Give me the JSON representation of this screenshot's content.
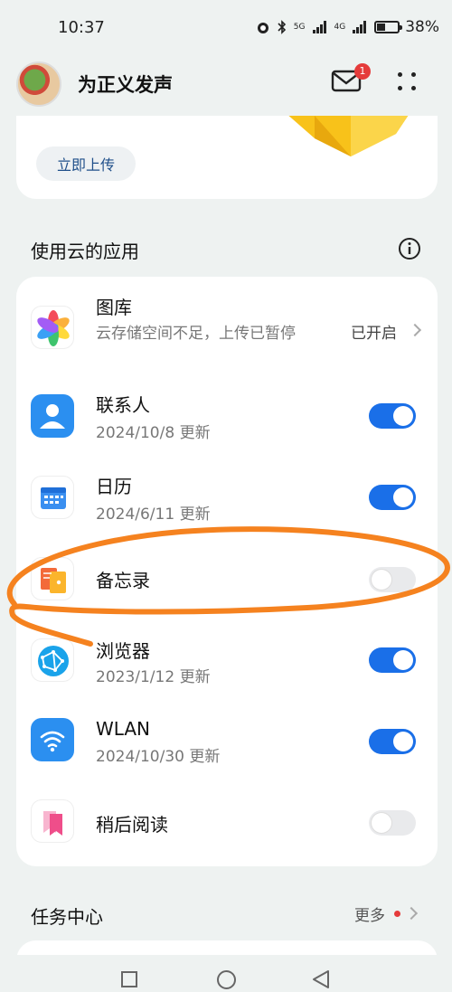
{
  "status_bar": {
    "time": "10:37",
    "network_5g": "5G",
    "network_4g": "4G",
    "battery": "38%",
    "battery_level": 0.38
  },
  "header": {
    "username": "为正义发声",
    "mail_badge": "1"
  },
  "upload_card": {
    "button_label": "立即上传"
  },
  "apps_section": {
    "title": "使用云的应用",
    "items": [
      {
        "name": "图库",
        "subtitle": "云存储空间不足，上传已暂停",
        "status": "已开启",
        "icon": "gallery-icon"
      },
      {
        "name": "联系人",
        "subtitle": "2024/10/8 更新",
        "toggle": true,
        "icon": "contacts-icon"
      },
      {
        "name": "日历",
        "subtitle": "2024/6/11 更新",
        "toggle": true,
        "icon": "calendar-icon"
      },
      {
        "name": "备忘录",
        "subtitle": "",
        "toggle": false,
        "icon": "notes-icon"
      },
      {
        "name": "浏览器",
        "subtitle": "2023/1/12 更新",
        "toggle": true,
        "icon": "browser-icon"
      },
      {
        "name": "WLAN",
        "subtitle": "2024/10/30 更新",
        "toggle": true,
        "icon": "wifi-icon"
      },
      {
        "name": "稍后阅读",
        "subtitle": "",
        "toggle": false,
        "icon": "read-later-icon"
      }
    ]
  },
  "task_center": {
    "title": "任务中心",
    "more_label": "更多"
  },
  "colors": {
    "accent_blue": "#1a6fe8",
    "annotation_orange": "#f5821f",
    "badge_red": "#e53b3b"
  }
}
